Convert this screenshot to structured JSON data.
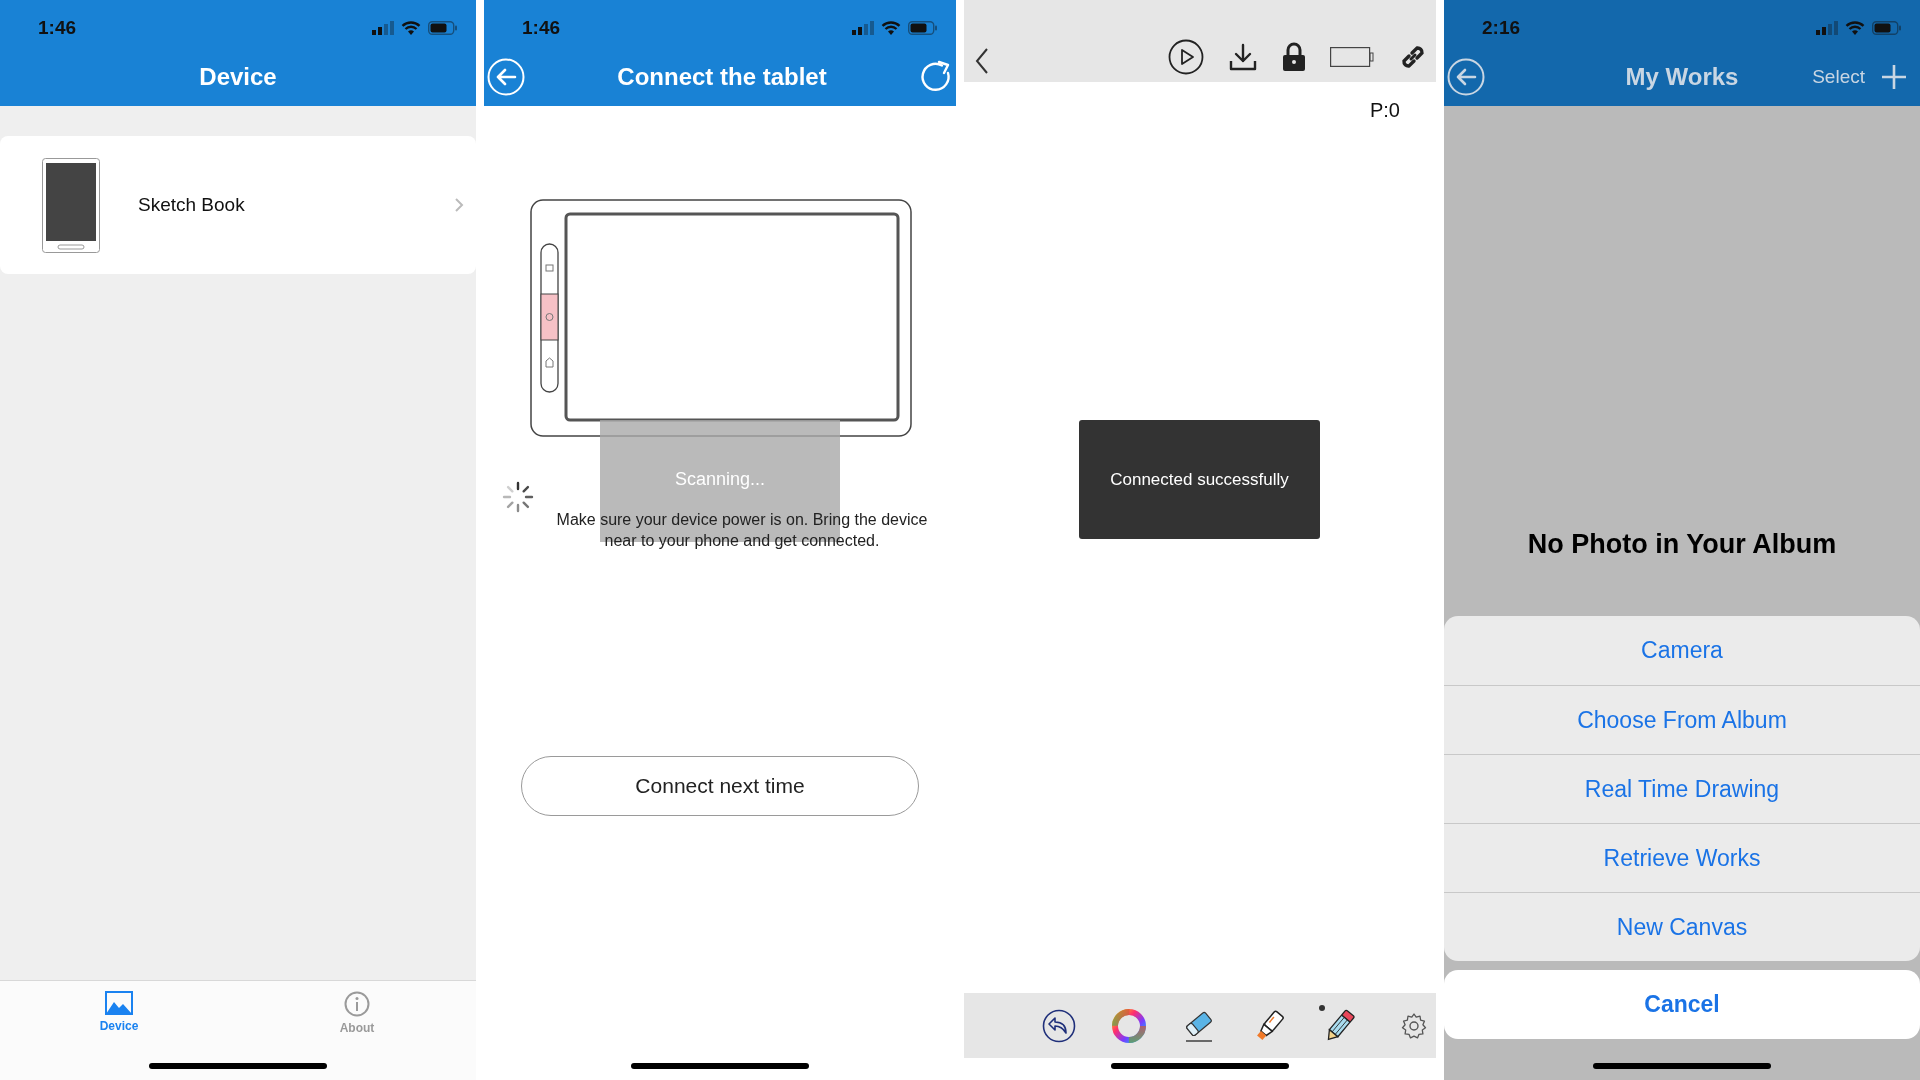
{
  "device_screen": {
    "status_time": "1:46",
    "title": "Device",
    "devices": [
      {
        "name": "Sketch Book"
      }
    ],
    "tabs": [
      {
        "label": "Device",
        "kind": "image",
        "selected": true
      },
      {
        "label": "About",
        "kind": "info",
        "selected": false
      }
    ]
  },
  "connect_screen": {
    "status_time": "1:46",
    "title": "Connect the tablet",
    "toast": "Scanning...",
    "hint": "Make sure your device power is on. Bring the device near to your phone and get connected.",
    "button": "Connect next time"
  },
  "canvas_screen": {
    "page_counter": "P:0",
    "toast": "Connected successfully",
    "tools": [
      {
        "kind": "undo",
        "selected": false
      },
      {
        "kind": "color",
        "selected": false
      },
      {
        "kind": "eraser",
        "selected": false
      },
      {
        "kind": "marker",
        "selected": false
      },
      {
        "kind": "pencil",
        "selected": true
      },
      {
        "kind": "settings",
        "selected": false
      }
    ]
  },
  "works_screen": {
    "status_time": "2:16",
    "title": "My Works",
    "select": "Select",
    "empty_message": "No Photo in Your Album",
    "actions": [
      "Camera",
      "Choose From Album",
      "Real Time Drawing",
      "Retrieve Works",
      "New Canvas"
    ],
    "cancel": "Cancel"
  }
}
